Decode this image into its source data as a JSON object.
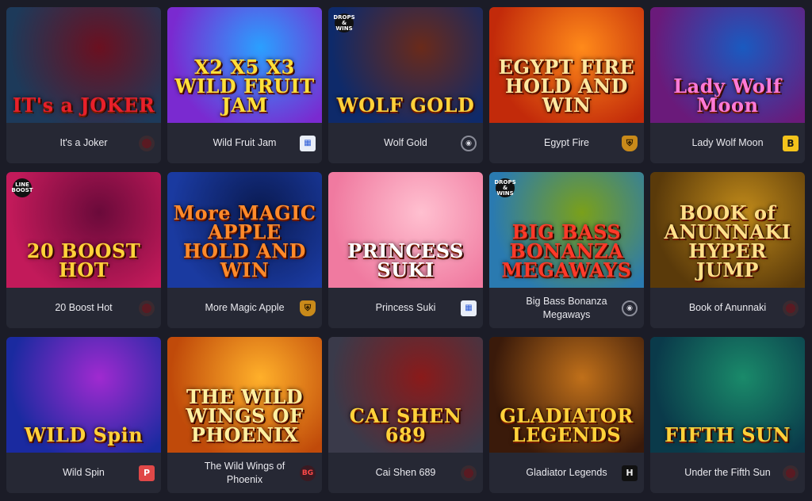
{
  "games": [
    {
      "name": "It's a Joker",
      "art_title": "IT's a JOKER",
      "provider_icon": "red-dot-provider-icon",
      "bg": [
        "#1d3a5a",
        "#6b1020"
      ],
      "title_color": "#e8202a"
    },
    {
      "name": "Wild Fruit Jam",
      "art_title": "X2 X5 X3 WILD FRUIT JAM",
      "provider_icon": "blue-square-provider-icon",
      "bg": [
        "#7a2ad0",
        "#2aa0ff"
      ],
      "title_color": "#ffe03a"
    },
    {
      "name": "Wolf Gold",
      "art_title": "WOLF GOLD",
      "provider_icon": "bomb-provider-icon",
      "bg": [
        "#0e2a6a",
        "#6a2a1a"
      ],
      "title_color": "#ffd23a",
      "badge": "DROPS & WINS"
    },
    {
      "name": "Egypt Fire",
      "art_title": "EGYPT FIRE HOLD AND WIN",
      "provider_icon": "shield-provider-icon",
      "bg": [
        "#c22a0a",
        "#ff8a1a"
      ],
      "title_color": "#ffe8a0"
    },
    {
      "name": "Lady Wolf Moon",
      "art_title": "Lady Wolf Moon",
      "provider_icon": "b-square-provider-icon",
      "bg": [
        "#6a1a7a",
        "#1a5ac0"
      ],
      "title_color": "#ff7ad8"
    },
    {
      "name": "20 Boost Hot",
      "art_title": "20 BOOST HOT",
      "provider_icon": "red-dot-provider-icon",
      "bg": [
        "#c21a5a",
        "#6a0a3a"
      ],
      "title_color": "#ffd23a",
      "badge": "LINE BOOST"
    },
    {
      "name": "More Magic Apple",
      "art_title": "More MAGIC APPLE HOLD AND WIN",
      "provider_icon": "shield-provider-icon",
      "bg": [
        "#1a3aa0",
        "#0a1a50"
      ],
      "title_color": "#ff8a2a"
    },
    {
      "name": "Princess Suki",
      "art_title": "PRINCESS SUKI",
      "provider_icon": "blue-square-provider-icon",
      "bg": [
        "#f07aa0",
        "#ffc0d0"
      ],
      "title_color": "#ffffff"
    },
    {
      "name": "Big Bass Bonanza Megaways",
      "art_title": "BIG BASS BONANZA MEGAWAYS",
      "provider_icon": "bomb-provider-icon",
      "bg": [
        "#2a7ab0",
        "#7aa01a"
      ],
      "title_color": "#ff3a2a",
      "badge": "DROPS & WINS"
    },
    {
      "name": "Book of Anunnaki",
      "art_title": "BOOK of ANUNNAKI HYPER JUMP",
      "provider_icon": "red-dot-provider-icon",
      "bg": [
        "#5a3a0a",
        "#c08a1a"
      ],
      "title_color": "#ffe08a"
    },
    {
      "name": "Wild Spin",
      "art_title": "WILD Spin",
      "provider_icon": "p-square-provider-icon",
      "bg": [
        "#1a2aa0",
        "#a02ad0"
      ],
      "title_color": "#ffd23a"
    },
    {
      "name": "The Wild Wings of Phoenix",
      "art_title": "THE WILD WINGS OF PHOENIX",
      "provider_icon": "bg-provider-icon",
      "bg": [
        "#c04a0a",
        "#ffb02a"
      ],
      "title_color": "#fff0a0"
    },
    {
      "name": "Cai Shen 689",
      "art_title": "CAI SHEN 689",
      "provider_icon": "red-dot-provider-icon",
      "bg": [
        "#3a3a4a",
        "#8a1a1a"
      ],
      "title_color": "#ffd23a"
    },
    {
      "name": "Gladiator Legends",
      "art_title": "GLADIATOR LEGENDS",
      "provider_icon": "h-square-provider-icon",
      "bg": [
        "#3a1a0a",
        "#c0701a"
      ],
      "title_color": "#ffd23a"
    },
    {
      "name": "Under the Fifth Sun",
      "art_title": "FIFTH SUN",
      "provider_icon": "red-dot-provider-icon",
      "bg": [
        "#0a3a4a",
        "#1a8a6a"
      ],
      "title_color": "#ffd23a"
    }
  ],
  "provider_glyphs": {
    "red-dot-provider-icon": "",
    "blue-square-provider-icon": "▦",
    "bomb-provider-icon": "◉",
    "shield-provider-icon": "⛨",
    "b-square-provider-icon": "B",
    "p-square-provider-icon": "P",
    "bg-provider-icon": "BG",
    "h-square-provider-icon": "H"
  }
}
